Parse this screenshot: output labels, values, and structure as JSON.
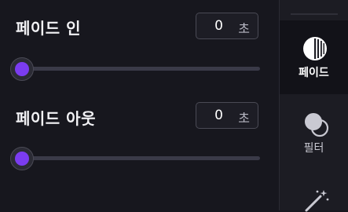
{
  "fade_in": {
    "title": "페이드 인",
    "value": "0",
    "unit": "초",
    "slider_position": 0
  },
  "fade_out": {
    "title": "페이드 아웃",
    "value": "0",
    "unit": "초",
    "slider_position": 0
  },
  "sidebar": {
    "items": [
      {
        "label": "페이드",
        "icon": "fade-icon",
        "active": true
      },
      {
        "label": "필터",
        "icon": "filter-icon",
        "active": false
      },
      {
        "label": "",
        "icon": "magic-wand-icon",
        "active": false
      }
    ]
  },
  "colors": {
    "accent": "#7b3cf0",
    "background": "#17171e",
    "sidebar": "#1c1c23"
  }
}
